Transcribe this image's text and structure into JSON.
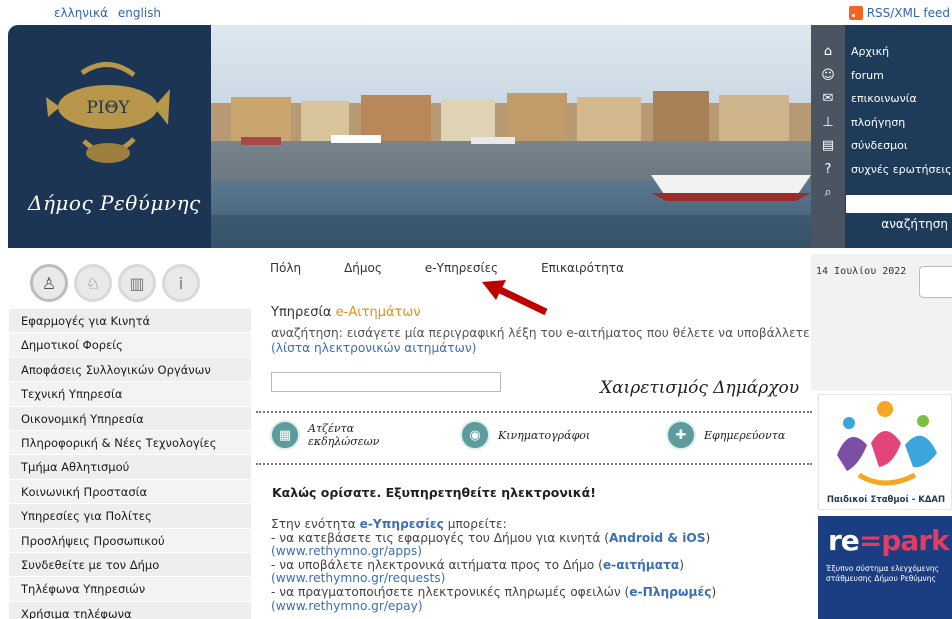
{
  "lang": {
    "el": "ελληνικά",
    "en": "english"
  },
  "rss": {
    "label": "RSS/XML feed"
  },
  "logo": {
    "emblem_text": "ΡΙΘΥ",
    "script_text": "Δήμος Ρεθύμνης"
  },
  "topnav": {
    "items": [
      "Αρχική",
      "forum",
      "επικοινωνία",
      "πλοήγηση",
      "σύνδεσμοι",
      "συχνές ερωτήσεις"
    ],
    "icons": [
      "home-icon",
      "people-icon",
      "mail-icon",
      "sitemap-icon",
      "links-icon",
      "question-icon",
      "search-icon"
    ],
    "search_label": "αναζήτηση"
  },
  "tabs": [
    "Πόλη",
    "Δήμος",
    "e-Υπηρεσίες",
    "Επικαιρότητα"
  ],
  "date": "14 Ιουλίου 2022",
  "sidebar": {
    "items": [
      "Εφαρμογές για Κινητά",
      "Δημοτικοί Φορείς",
      "Αποφάσεις Συλλογικών Οργάνων",
      "Τεχνική Υπηρεσία",
      "Οικονομική Υπηρεσία",
      "Πληροφορική & Νέες Τεχνολογίες",
      "Τμήμα Αθλητισμού",
      "Κοινωνική Προστασία",
      "Υπηρεσίες για Πολίτες",
      "Προσλήψεις Προσωπικού",
      "Συνδεθείτε με τον Δήμο",
      "Τηλέφωνα Υπηρεσιών",
      "Χρήσιμα τηλέφωνα"
    ]
  },
  "service": {
    "title_prefix": "Υπηρεσία ",
    "title_accent": "e-Αιτημάτων",
    "desc": "αναζήτηση: εισάγετε μία περιγραφική λέξη του e-αιτήματος που θέλετε να υποβάλλετε",
    "list_link": "(λίστα ηλεκτρονικών αιτημάτων)"
  },
  "greeting": "Χαιρετισμός Δημάρχου",
  "quick_links": [
    {
      "line1": "Ατζέντα",
      "line2": "εκδηλώσεων",
      "icon": "calendar-icon"
    },
    {
      "line1": "Κινηματογράφοι",
      "line2": "",
      "icon": "film-icon"
    },
    {
      "line1": "Εφημερεύοντα",
      "line2": "",
      "icon": "cross-icon"
    }
  ],
  "welcome": "Καλώς ορίσατε. Εξυπηρετηθείτε ηλεκτρονικά!",
  "body": {
    "intro_a": "Στην ενότητα ",
    "intro_b": "e-Υπηρεσίες",
    "intro_c": " μπορείτε:",
    "l1_a": "- να κατεβάσετε τις εφαρμογές του Δήμου για κινητά (",
    "l1_b": "Android & iOS",
    "l1_c": ")",
    "l1_url": "(www.rethymno.gr/apps)",
    "l2_a": "- να υποβάλετε ηλεκτρονικά αιτήματα προς το Δήμο (",
    "l2_b": "e-αιτήματα",
    "l2_c": ")",
    "l2_url": "(www.rethymno.gr/requests)",
    "l3_a": "- να πραγματοποιήσετε ηλεκτρονικές πληρωμές οφειλών (",
    "l3_b": "e-Πληρωμές",
    "l3_c": ")",
    "l3_url": "(www.rethymno.gr/epay)"
  },
  "banners": {
    "kdap_caption": "Παιδικοί Σταθμοί - ΚΔΑΠ",
    "repark_re": "re",
    "repark_sym": "=",
    "repark_park": "park",
    "repark_small": "Έξυπνο σύστημα ελεγχόμενης στάθμευσης Δήμου Ρεθύμνης"
  }
}
